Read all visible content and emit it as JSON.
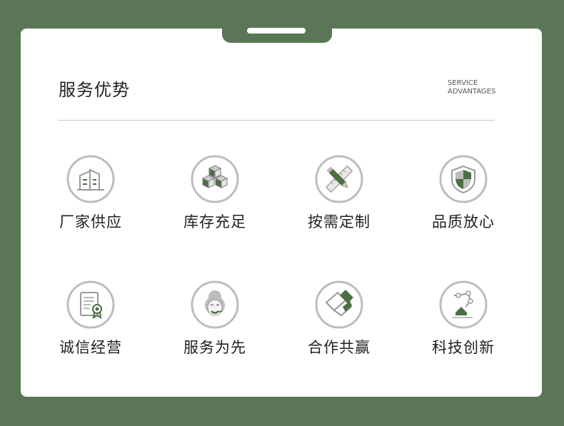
{
  "header": {
    "title": "服务优势",
    "subtitle_line1": "SERVICE",
    "subtitle_line2": "ADVANTAGES"
  },
  "colors": {
    "background": "#5b7657",
    "icon_accent": "#4b6e42",
    "icon_ring": "#bdbdbd"
  },
  "features": [
    {
      "label": "厂家供应",
      "icon": "factory-building-icon"
    },
    {
      "label": "库存充足",
      "icon": "stacked-boxes-icon"
    },
    {
      "label": "按需定制",
      "icon": "pencil-ruler-icon"
    },
    {
      "label": "品质放心",
      "icon": "shield-icon"
    },
    {
      "label": "诚信经营",
      "icon": "certificate-icon"
    },
    {
      "label": "服务为先",
      "icon": "customer-service-icon"
    },
    {
      "label": "合作共赢",
      "icon": "handshake-icon"
    },
    {
      "label": "科技创新",
      "icon": "robot-arm-icon"
    }
  ]
}
